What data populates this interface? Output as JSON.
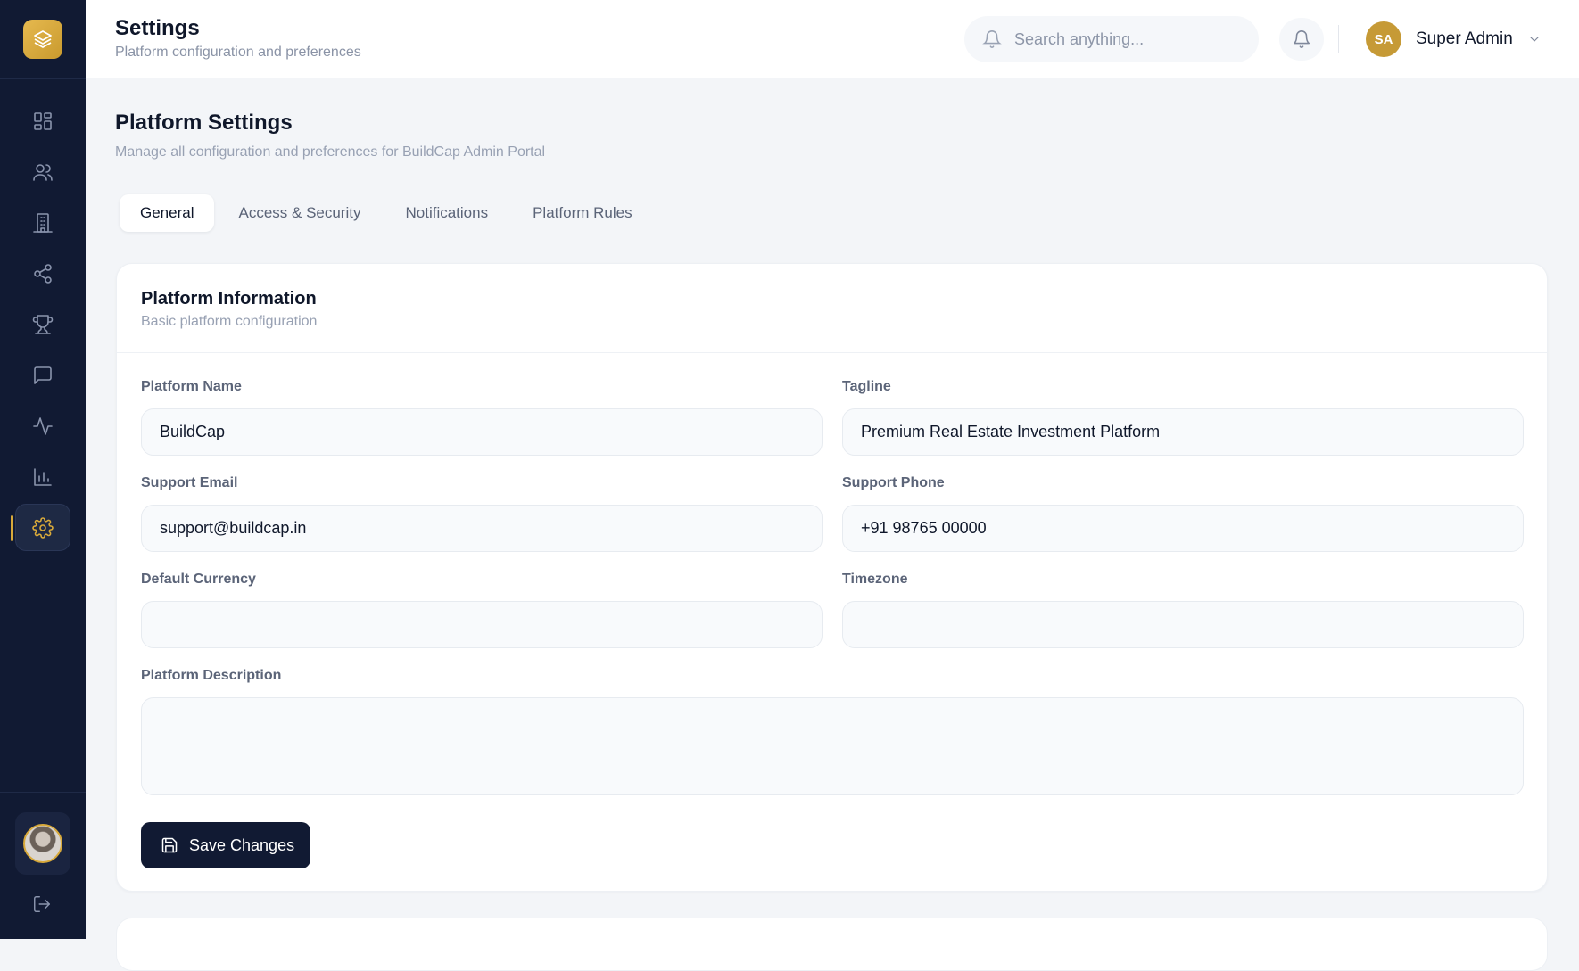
{
  "header": {
    "title": "Settings",
    "subtitle": "Platform configuration and preferences",
    "search_placeholder": "Search anything...",
    "user": {
      "initials": "SA",
      "name": "Super Admin"
    }
  },
  "sidebar": {
    "items": [
      {
        "icon": "dashboard-grid-icon"
      },
      {
        "icon": "users-icon"
      },
      {
        "icon": "building-icon"
      },
      {
        "icon": "share-icon"
      },
      {
        "icon": "trophy-icon"
      },
      {
        "icon": "message-icon"
      },
      {
        "icon": "activity-icon"
      },
      {
        "icon": "bar-chart-icon"
      },
      {
        "icon": "gear-icon",
        "active": true
      }
    ]
  },
  "main": {
    "title": "Platform Settings",
    "subtitle": "Manage all configuration and preferences for BuildCap Admin Portal",
    "tabs": [
      {
        "label": "General",
        "active": true
      },
      {
        "label": "Access & Security"
      },
      {
        "label": "Notifications"
      },
      {
        "label": "Platform Rules"
      }
    ],
    "card": {
      "title": "Platform Information",
      "subtitle": "Basic platform configuration",
      "fields": {
        "platform_name": {
          "label": "Platform Name",
          "value": "BuildCap"
        },
        "tagline": {
          "label": "Tagline",
          "value": "Premium Real Estate Investment Platform"
        },
        "support_email": {
          "label": "Support Email",
          "value": "support@buildcap.in"
        },
        "support_phone": {
          "label": "Support Phone",
          "value": "+91 98765 00000"
        },
        "default_currency": {
          "label": "Default Currency",
          "value": ""
        },
        "timezone": {
          "label": "Timezone",
          "value": ""
        },
        "description": {
          "label": "Platform Description",
          "value": ""
        }
      },
      "save_label": "Save Changes"
    }
  },
  "colors": {
    "sidebar_bg": "#111a33",
    "accent_gold": "#d8a93a",
    "primary_button": "#111a33",
    "page_bg": "#f3f5f8"
  }
}
